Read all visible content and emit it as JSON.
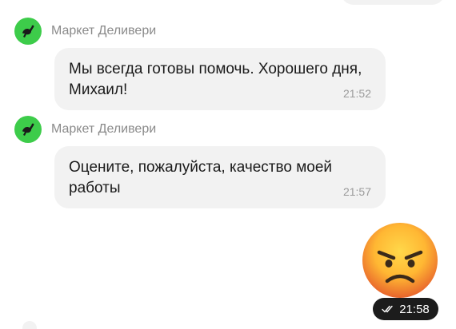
{
  "messages": [
    {
      "sender": "Маркет Деливери",
      "text": "Мы всегда готовы помочь. Хорошего дня, Михаил!",
      "time": "21:52"
    },
    {
      "sender": "Маркет Деливери",
      "text": "Оцените, пожалуйста, качество моей работы",
      "time": "21:57"
    }
  ],
  "sent": {
    "emoji": "angry-face",
    "time": "21:58",
    "status_icon": "double-check-icon"
  },
  "colors": {
    "avatar_bg": "#3dcc4a",
    "bubble_bg": "#f2f2f2",
    "time_pill_bg": "#1c1c1c",
    "emoji_face": "#ffcc33",
    "emoji_anger": "#e8642c"
  }
}
